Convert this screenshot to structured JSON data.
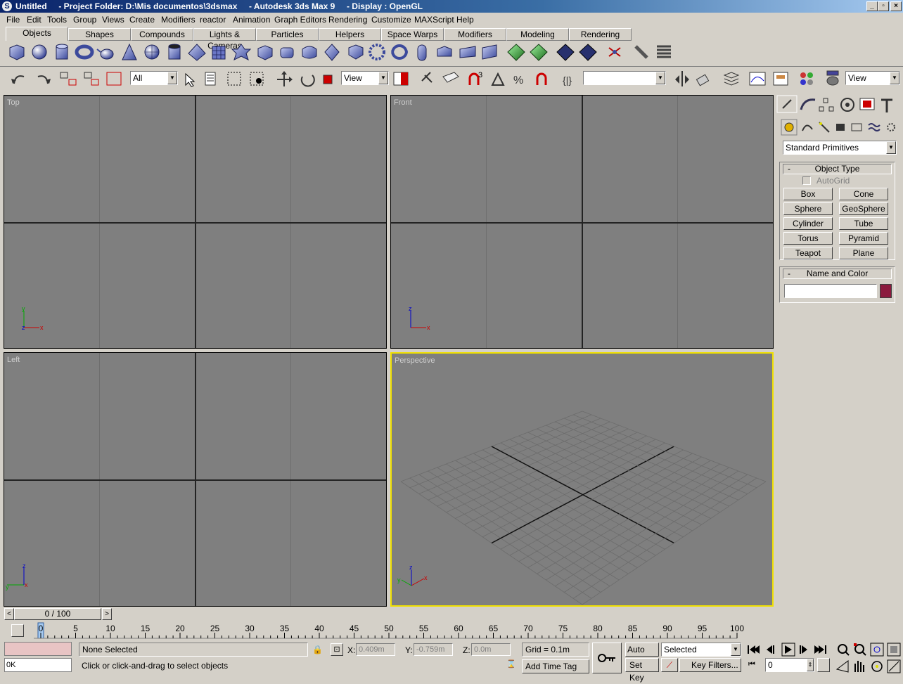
{
  "window": {
    "title": "Untitled     - Project Folder: D:\\Mis documentos\\3dsmax     - Autodesk 3ds Max 9     - Display : OpenGL"
  },
  "menu": [
    "File",
    "Edit",
    "Tools",
    "Group",
    "Views",
    "Create",
    "Modifiers",
    "reactor",
    "Animation",
    "Graph Editors",
    "Rendering",
    "Customize",
    "MAXScript",
    "Help"
  ],
  "tabs": [
    "Objects",
    "Shapes",
    "Compounds",
    "Lights & Cameras",
    "Particles",
    "Helpers",
    "Space Warps",
    "Modifiers",
    "Modeling",
    "Rendering"
  ],
  "toolbar": {
    "selection_filter": "All",
    "ref_coord": "View",
    "named_sel": "",
    "render_view": "View"
  },
  "viewports": {
    "top": "Top",
    "front": "Front",
    "left": "Left",
    "perspective": "Perspective"
  },
  "axis": {
    "x": "x",
    "y": "y",
    "z": "z"
  },
  "command_panel": {
    "category": "Standard Primitives",
    "object_type_title": "Object Type",
    "autogrid": "AutoGrid",
    "buttons": [
      "Box",
      "Cone",
      "Sphere",
      "GeoSphere",
      "Cylinder",
      "Tube",
      "Torus",
      "Pyramid",
      "Teapot",
      "Plane"
    ],
    "name_color_title": "Name and Color",
    "rollout_minus": "-",
    "object_color": "#8b1a3e"
  },
  "time": {
    "slider": "0 / 100",
    "ticks": [
      "0",
      "5",
      "10",
      "15",
      "20",
      "25",
      "30",
      "35",
      "40",
      "45",
      "50",
      "55",
      "60",
      "65",
      "70",
      "75",
      "80",
      "85",
      "90",
      "95",
      "100"
    ]
  },
  "status": {
    "selection": "None Selected",
    "prompt": "Click or click-and-drag to select objects",
    "x_label": "X:",
    "x": "0.409m",
    "y_label": "Y:",
    "y": "-0.759m",
    "z_label": "Z:",
    "z": "0.0m",
    "grid": "Grid = 0.1m",
    "add_time_tag": "Add Time Tag",
    "auto_key": "Auto Key",
    "set_key": "Set Key",
    "key_mode": "Selected",
    "key_filters": "Key Filters...",
    "frame": "0",
    "listener": "0K"
  },
  "colors": {
    "viewport_bg": "#7f7f7f",
    "active_border": "#f0e000",
    "titlebar": "#0a246a"
  }
}
